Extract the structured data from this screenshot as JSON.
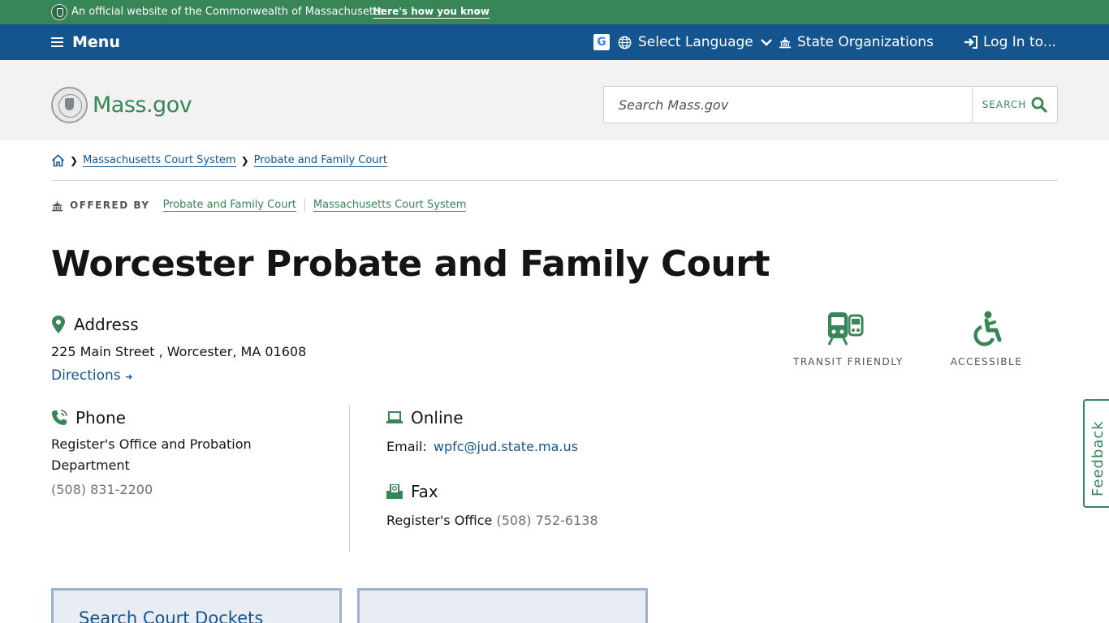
{
  "official_bar": {
    "text": "An official website of the Commonwealth of Massachusetts",
    "link": "Here's how you know"
  },
  "nav": {
    "menu_label": "Menu",
    "language_label": "Select Language",
    "state_orgs_label": "State Organizations",
    "login_label": "Log In to..."
  },
  "header": {
    "logo_text": "Mass.gov",
    "search_placeholder": "Search Mass.gov",
    "search_button": "SEARCH"
  },
  "breadcrumb": {
    "items": [
      "Massachusetts Court System",
      "Probate and Family Court"
    ]
  },
  "offered_by": {
    "label": "OFFERED BY",
    "orgs": [
      "Probate and Family Court",
      "Massachusetts Court System"
    ]
  },
  "page_title": "Worcester Probate and Family Court",
  "address": {
    "heading": "Address",
    "line": "225 Main Street , Worcester, MA 01608",
    "directions": "Directions"
  },
  "phone": {
    "heading": "Phone",
    "desc": "Register's Office and Probation Department",
    "number": "(508) 831-2200"
  },
  "online": {
    "heading": "Online",
    "email_label": "Email:",
    "email": "wpfc@jud.state.ma.us"
  },
  "fax": {
    "heading": "Fax",
    "label": "Register's Office",
    "number": "(508) 752-6138"
  },
  "features": [
    {
      "label": "TRANSIT FRIENDLY",
      "icon": "transit-icon"
    },
    {
      "label": "ACCESSIBLE",
      "icon": "accessible-icon"
    }
  ],
  "feedback_label": "Feedback",
  "cards": [
    {
      "title": "Search Court Dockets"
    },
    {
      "title": ""
    }
  ],
  "colors": {
    "green": "#388557",
    "blue": "#14558f",
    "header_gray": "#f2f2f2"
  }
}
